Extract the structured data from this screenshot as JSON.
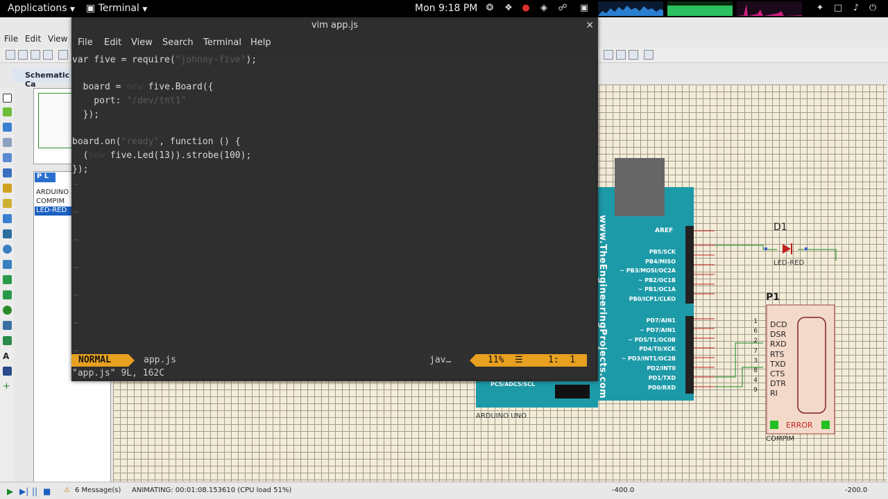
{
  "topbar": {
    "applications": "Applications",
    "terminal": "Terminal",
    "clock": "Mon  9:18 PM"
  },
  "proteus": {
    "menu": [
      "File",
      "Edit",
      "View"
    ],
    "tab": "Schematic Ca",
    "devices_header": "P L",
    "devices": [
      "ARDUINO U",
      "COMPIM",
      "LED-RED"
    ],
    "status": {
      "messages": "6 Message(s)",
      "animating": "ANIMATING: 00:01:08.153610 (CPU load 51%)",
      "coord_x": "-400.0",
      "coord_y": "-200.0"
    },
    "board": {
      "url": "www.TheEngineeringProjects.com",
      "aref": "AREF",
      "pins_top": [
        "PB5/SCK",
        "PB4/MISO",
        "~ PB3/MOSI/OC2A",
        "~ PB2/OC1B",
        "~ PB1/OC1A",
        "PB0/ICP1/CLKO"
      ],
      "pins_bottom": [
        "PD7/AIN1",
        "~ PD7/AIN1",
        "~ PD5/T1/OC0B",
        "PD4/T0/XCK",
        "~ PD3/INT1/OC2B",
        "PD2/INT0",
        "PD1/TXD",
        "PD0/RXD"
      ],
      "analog": "PC5/ADC5/SCL",
      "name": "ARDUINO UNO"
    },
    "led": {
      "ref": "D1",
      "name": "LED-RED"
    },
    "compim": {
      "ref": "P1",
      "pins": [
        "DCD",
        "DSR",
        "RXD",
        "RTS",
        "TXD",
        "CTS",
        "DTR",
        "RI"
      ],
      "pin_nums": [
        "1",
        "6",
        "2",
        "7",
        "3",
        "8",
        "4",
        "9"
      ],
      "error": "ERROR",
      "name": "COMPIM"
    }
  },
  "terminal": {
    "title": "vim app.js",
    "menu": [
      "File",
      "Edit",
      "View",
      "Search",
      "Terminal",
      "Help"
    ],
    "code": {
      "l1_a": "var five = require(",
      "l1_s": "\"johnny-five\"",
      "l1_b": ");",
      "l3_a": "  board = ",
      "l3_k": "new",
      "l3_b": " five.Board({",
      "l4_a": "    port: ",
      "l4_s": "\"/dev/tnt1\"",
      "l5": "  });",
      "l7_a": "board.on(",
      "l7_s": "\"ready\"",
      "l7_b": ", function () {",
      "l8_a": "  (",
      "l8_k": "new",
      "l8_b": " five.Led(13)).strobe(100);",
      "l9": "});"
    },
    "tilde": "~",
    "vim": {
      "mode": "NORMAL",
      "file": "app.js",
      "filetype": "jav…",
      "percent": "11%",
      "lines_icon": "☰",
      "pos": "1:  1",
      "cmdline": "\"app.js\" 9L, 162C"
    }
  },
  "colors": {
    "vim_mode_bg": "#e8a020",
    "board_teal": "#1d9aa8",
    "wire_green": "#1a8a1a",
    "wire_red": "#c02020"
  }
}
